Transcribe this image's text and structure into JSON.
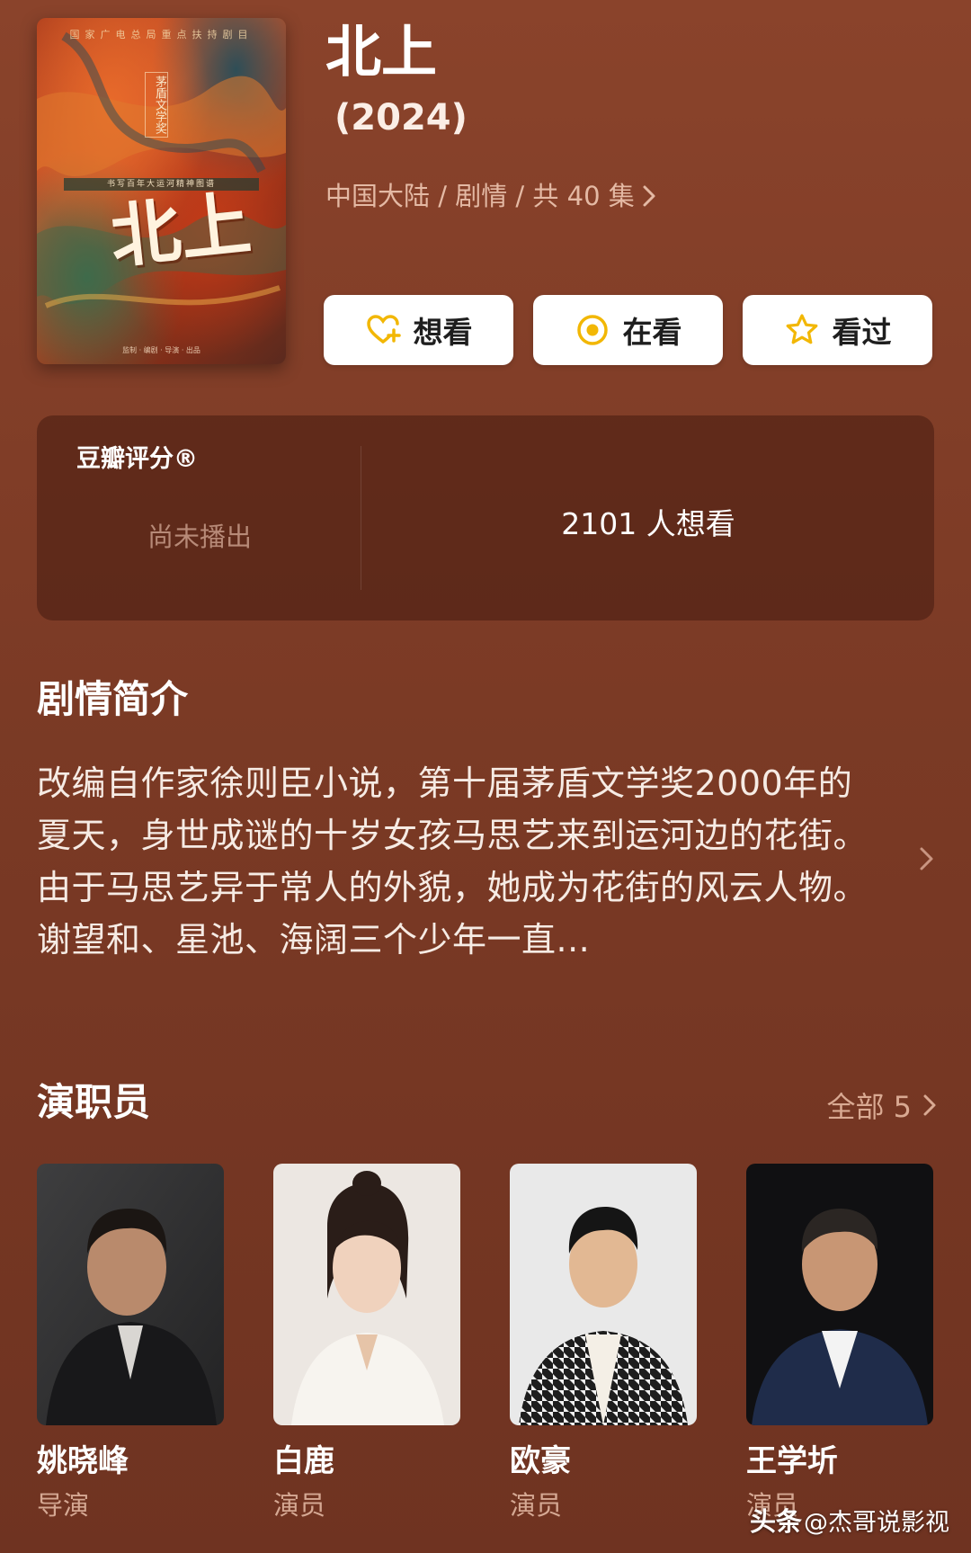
{
  "poster": {
    "top_line": "国家广电总局重点扶持剧目",
    "award": "茅盾文学奖",
    "band_text": "书写百年大运河精神图谱",
    "title_art": "北上",
    "credits": "监制 · 编剧 · 导演 · 出品"
  },
  "show": {
    "title": "北上",
    "year": "(2024)",
    "meta": "中国大陆 / 剧情 / 共 40 集"
  },
  "actions": [
    {
      "label": "想看",
      "icon": "heart-plus-icon"
    },
    {
      "label": "在看",
      "icon": "circle-dot-icon"
    },
    {
      "label": "看过",
      "icon": "star-icon"
    }
  ],
  "rating": {
    "label": "豆瓣评分®",
    "status": "尚未播出",
    "want_count": "2101 人想看"
  },
  "synopsis": {
    "title": "剧情简介",
    "text": "改编自作家徐则臣小说，第十届茅盾文学奖2000年的夏天，身世成谜的十岁女孩马思艺来到运河边的花街。由于马思艺异于常人的外貌，她成为花街的风云人物。谢望和、星池、海阔三个少年一直..."
  },
  "cast": {
    "title": "演职员",
    "see_all": "全部 5",
    "members": [
      {
        "name": "姚晓峰",
        "role": "导演"
      },
      {
        "name": "白鹿",
        "role": "演员"
      },
      {
        "name": "欧豪",
        "role": "演员"
      },
      {
        "name": "王学圻",
        "role": "演员"
      }
    ]
  },
  "watermark": {
    "app": "头条",
    "account": "@杰哥说影视"
  },
  "colors": {
    "background": "#7a3a26",
    "card": "#4a1c10",
    "accent_yellow": "#f2b705",
    "muted_text": "#d5a893"
  }
}
